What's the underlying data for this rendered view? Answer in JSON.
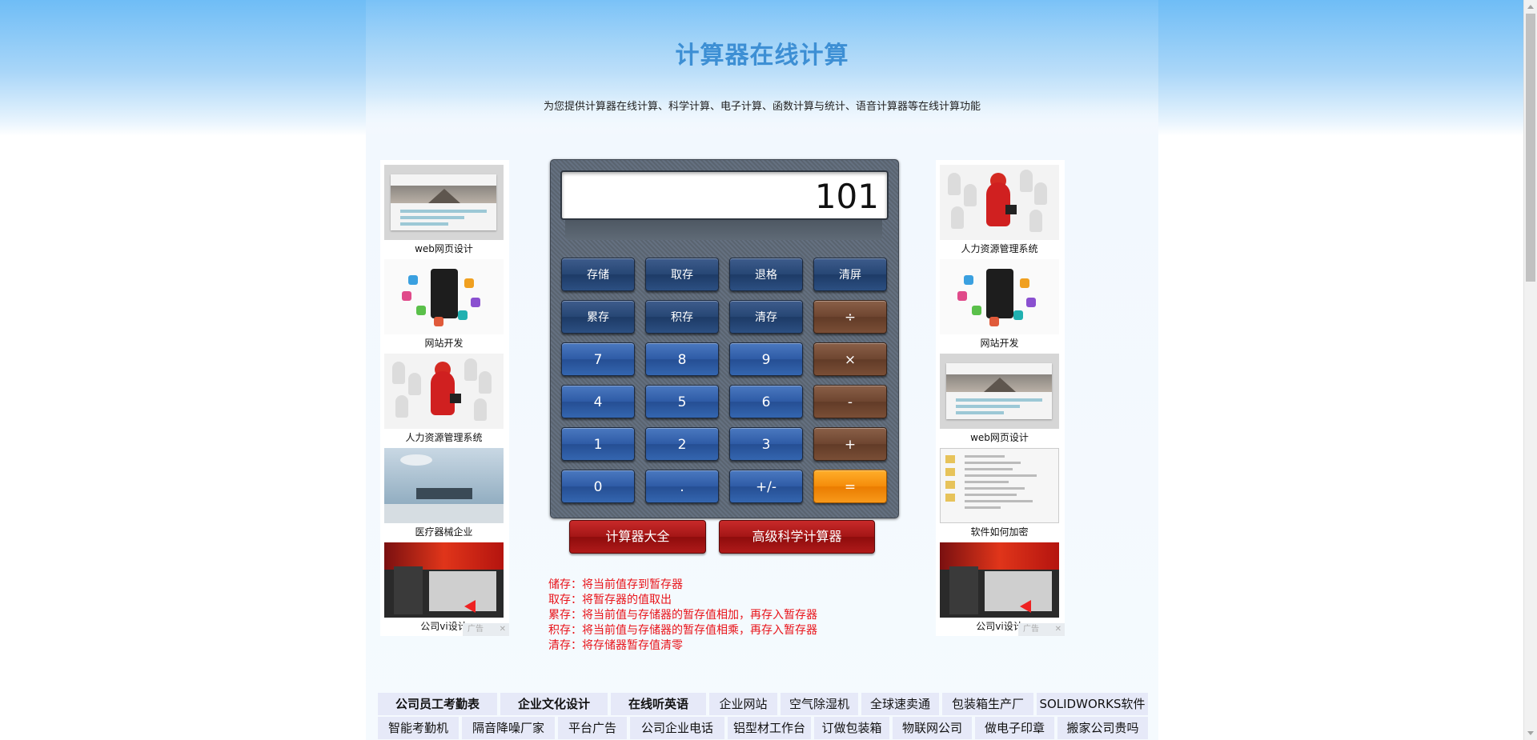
{
  "header": {
    "title": "计算器在线计算",
    "subtitle": "为您提供计算器在线计算、科学计算、电子计算、函数计算与统计、语音计算器等在线计算功能"
  },
  "ads_left": {
    "items": [
      "web网页设计",
      "网站开发",
      "人力资源管理系统",
      "医疗器械企业",
      "公司vi设计"
    ],
    "badge": "广告"
  },
  "ads_right": {
    "items": [
      "人力资源管理系统",
      "网站开发",
      "web网页设计",
      "软件如何加密",
      "公司vi设计"
    ],
    "badge": "广告"
  },
  "calculator": {
    "display": "101",
    "buttons": {
      "store": "存储",
      "recall": "取存",
      "backspace": "退格",
      "clear_screen": "清屏",
      "accumulate": "累存",
      "product_store": "积存",
      "clear_store": "清存",
      "divide": "÷",
      "seven": "7",
      "eight": "8",
      "nine": "9",
      "multiply": "×",
      "four": "4",
      "five": "5",
      "six": "6",
      "minus": "-",
      "one": "1",
      "two": "2",
      "three": "3",
      "plus": "+",
      "zero": "0",
      "dot": ".",
      "negate": "+/-",
      "equals": "="
    },
    "calc_all": "计算器大全",
    "advanced": "高级科学计算器"
  },
  "notes": [
    "储存：将当前值存到暂存器",
    "取存：将暂存器的值取出",
    "累存：将当前值与存储器的暂存值相加，再存入暂存器",
    "积存：将当前值与存储器的暂存值相乘，再存入暂存器",
    "清存：将存储器暂存值清零"
  ],
  "links": {
    "row1": [
      "公司员工考勤表",
      "企业文化设计",
      "在线听英语",
      "企业网站",
      "空气除湿机",
      "全球速卖通",
      "包装箱生产厂",
      "SOLIDWORKS软件"
    ],
    "row2": [
      "智能考勤机",
      "隔音降噪厂家",
      "平台广告",
      "公司企业电话",
      "铝型材工作台",
      "订做包装箱",
      "物联网公司",
      "做电子印章",
      "搬家公司贵吗"
    ]
  }
}
